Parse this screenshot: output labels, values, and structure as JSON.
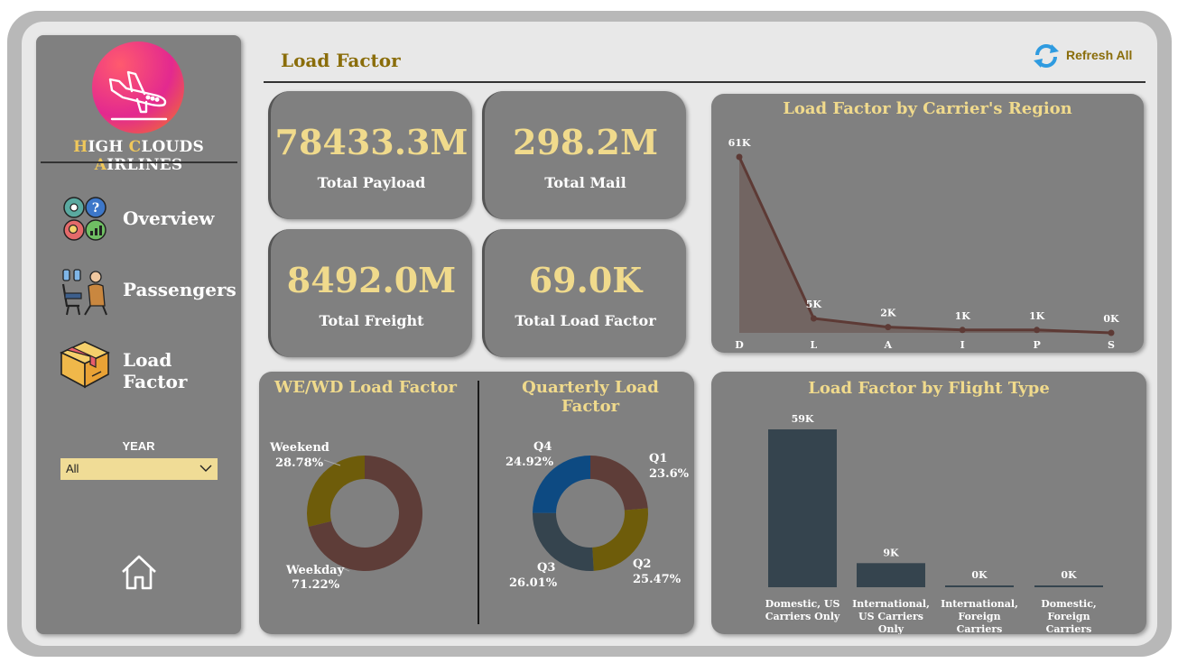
{
  "sidebar": {
    "brand": {
      "h": "H",
      "igh": "IGH ",
      "c": "C",
      "louds": "LOUDS ",
      "a": "A",
      "irlines": "IRLINES"
    },
    "nav": [
      {
        "label": "Overview",
        "icon": "overview-icon"
      },
      {
        "label": "Passengers",
        "icon": "passenger-seat-icon"
      },
      {
        "label": "Load Factor",
        "icon": "package-box-icon"
      }
    ],
    "year_label": "YEAR",
    "year_value": "All",
    "home_icon": "home-icon"
  },
  "header": {
    "title": "Load Factor",
    "refresh_label": "Refresh All"
  },
  "kpis": [
    {
      "value": "78433.3M",
      "label": "Total Payload"
    },
    {
      "value": "298.2M",
      "label": "Total Mail"
    },
    {
      "value": "8492.0M",
      "label": "Total Freight"
    },
    {
      "value": "69.0K",
      "label": "Total Load Factor"
    }
  ],
  "colors": {
    "panel": "#808080",
    "title_gold": "#f0da8c",
    "accent_dark_gold": "#8a6d0a",
    "area_line": "#5d3a35",
    "bar": "#35444e",
    "weekend": "#6e5c0a",
    "weekday": "#5e3d38",
    "q1": "#5e3d38",
    "q2": "#6e5c0a",
    "q3": "#35444e",
    "q4": "#0d4a82"
  },
  "chart_data": [
    {
      "type": "area",
      "title": "Load Factor by Carrier's Region",
      "categories": [
        "D",
        "L",
        "A",
        "I",
        "P",
        "S"
      ],
      "values": [
        61,
        5,
        2,
        1,
        1,
        0
      ],
      "data_labels": [
        "61K",
        "5K",
        "2K",
        "1K",
        "1K",
        "0K"
      ],
      "ylim": [
        0,
        61
      ]
    },
    {
      "type": "bar",
      "title": "Load Factor by Flight Type",
      "categories": [
        [
          "Domestic, US",
          "Carriers Only"
        ],
        [
          "International,",
          "US Carriers",
          "Only"
        ],
        [
          "International,",
          "Foreign",
          "Carriers"
        ],
        [
          "Domestic,",
          "Foreign",
          "Carriers"
        ]
      ],
      "values": [
        59,
        9,
        0,
        0
      ],
      "data_labels": [
        "59K",
        "9K",
        "0K",
        "0K"
      ],
      "ylim": [
        0,
        59
      ]
    },
    {
      "type": "pie",
      "title": "WE/WD Load Factor",
      "labels": [
        "Weekend",
        "Weekday"
      ],
      "values": [
        28.78,
        71.22
      ],
      "value_labels": [
        "28.78%",
        "71.22%"
      ]
    },
    {
      "type": "pie",
      "title": "Quarterly Load Factor",
      "labels": [
        "Q1",
        "Q2",
        "Q3",
        "Q4"
      ],
      "values": [
        23.6,
        25.47,
        26.01,
        24.92
      ],
      "value_labels": [
        "23.6%",
        "25.47%",
        "26.01%",
        "24.92%"
      ]
    }
  ]
}
